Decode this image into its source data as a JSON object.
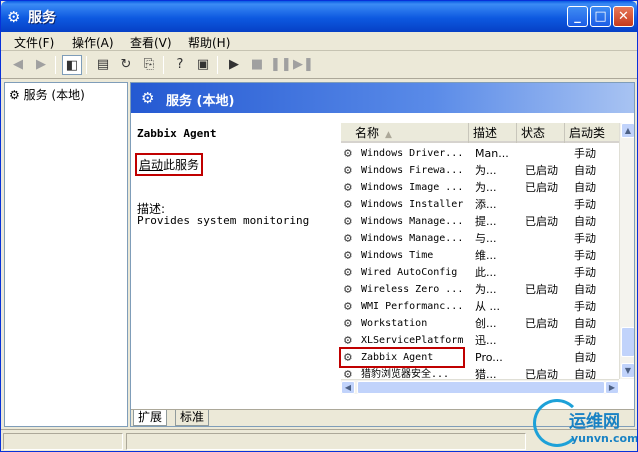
{
  "window": {
    "title": "服务",
    "icon": "services-gear-icon"
  },
  "menubar": [
    {
      "label": "文件(F)"
    },
    {
      "label": "操作(A)"
    },
    {
      "label": "查看(V)"
    },
    {
      "label": "帮助(H)"
    }
  ],
  "toolbar": {
    "icons": [
      "back-arrow-icon",
      "forward-arrow-icon",
      "show-hide-tree-icon",
      "properties-icon",
      "refresh-icon",
      "export-list-icon",
      "help-icon",
      "console-icon",
      "start-icon",
      "stop-icon",
      "pause-icon",
      "restart-icon"
    ]
  },
  "tree": {
    "root_label": "服务 (本地)"
  },
  "detail": {
    "header_title": "服务 (本地)",
    "selected_service": "Zabbix Agent",
    "start_link_prefix": "启动",
    "start_link_suffix": "此服务",
    "description_label": "描述:",
    "description_text": "Provides system monitoring"
  },
  "list": {
    "columns": [
      "名称",
      "描述",
      "状态",
      "启动类"
    ],
    "rows": [
      {
        "name": "Windows Driver...",
        "desc": "Man...",
        "status": "",
        "startup": "手动"
      },
      {
        "name": "Windows Firewa...",
        "desc": "为...",
        "status": "已启动",
        "startup": "自动"
      },
      {
        "name": "Windows Image ...",
        "desc": "为...",
        "status": "已启动",
        "startup": "自动"
      },
      {
        "name": "Windows Installer",
        "desc": "添...",
        "status": "",
        "startup": "手动"
      },
      {
        "name": "Windows Manage...",
        "desc": "提...",
        "status": "已启动",
        "startup": "自动"
      },
      {
        "name": "Windows Manage...",
        "desc": "与...",
        "status": "",
        "startup": "手动"
      },
      {
        "name": "Windows Time",
        "desc": "维...",
        "status": "",
        "startup": "手动"
      },
      {
        "name": "Wired AutoConfig",
        "desc": "此...",
        "status": "",
        "startup": "手动"
      },
      {
        "name": "Wireless Zero ...",
        "desc": "为...",
        "status": "已启动",
        "startup": "自动"
      },
      {
        "name": "WMI Performanc...",
        "desc": "从 ...",
        "status": "",
        "startup": "手动"
      },
      {
        "name": "Workstation",
        "desc": "创...",
        "status": "已启动",
        "startup": "自动"
      },
      {
        "name": "XLServicePlatform",
        "desc": "迅...",
        "status": "",
        "startup": "手动"
      },
      {
        "name": "Zabbix Agent",
        "desc": "Pro...",
        "status": "",
        "startup": "自动"
      },
      {
        "name": "猎豹浏览器安全...",
        "desc": "猎...",
        "status": "已启动",
        "startup": "自动"
      }
    ]
  },
  "tabs": [
    {
      "label": "扩展"
    },
    {
      "label": "标准"
    }
  ],
  "watermark": {
    "name": "运维网",
    "url": "yunvn.com"
  }
}
